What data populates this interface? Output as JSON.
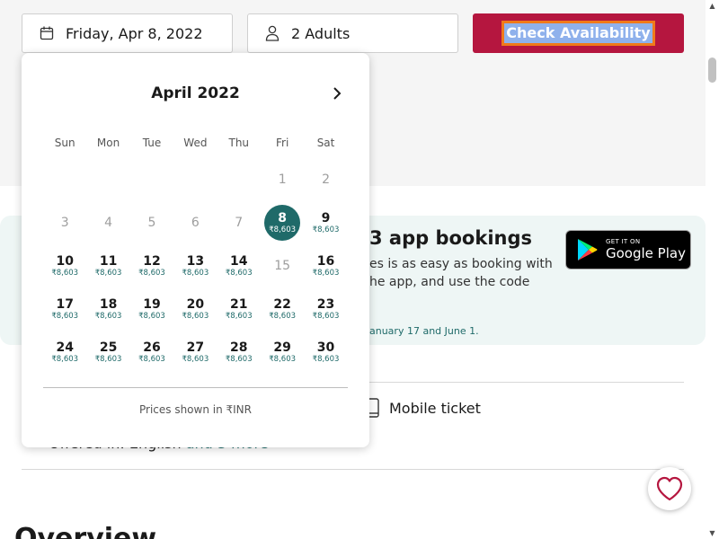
{
  "search_bar": {
    "date_value": "Friday, Apr 8, 2022",
    "guests_value": "2 Adults",
    "check_label": "Check Availability"
  },
  "promo": {
    "title": "3 app bookings",
    "text": "es is as easy as booking with he app, and use the code",
    "note": "anuary 17 and June 1.",
    "store_small": "GET IT ON",
    "store_big": "Google Play"
  },
  "details": {
    "mobile_ticket": "Mobile ticket",
    "offered_prefix": "Offered in: English",
    "offered_more": "and 3 more"
  },
  "overview_heading": "Overview",
  "calendar": {
    "month_title": "April 2022",
    "weekdays": [
      "Sun",
      "Mon",
      "Tue",
      "Wed",
      "Thu",
      "Fri",
      "Sat"
    ],
    "leading_blanks": 5,
    "days": [
      {
        "day": "1",
        "price": "",
        "disabled": true
      },
      {
        "day": "2",
        "price": "",
        "disabled": true
      },
      {
        "day": "3",
        "price": "",
        "disabled": true
      },
      {
        "day": "4",
        "price": "",
        "disabled": true
      },
      {
        "day": "5",
        "price": "",
        "disabled": true
      },
      {
        "day": "6",
        "price": "",
        "disabled": true
      },
      {
        "day": "7",
        "price": "",
        "disabled": true
      },
      {
        "day": "8",
        "price": "₹8,603",
        "selected": true
      },
      {
        "day": "9",
        "price": "₹8,603"
      },
      {
        "day": "10",
        "price": "₹8,603"
      },
      {
        "day": "11",
        "price": "₹8,603"
      },
      {
        "day": "12",
        "price": "₹8,603"
      },
      {
        "day": "13",
        "price": "₹8,603"
      },
      {
        "day": "14",
        "price": "₹8,603"
      },
      {
        "day": "15",
        "price": "",
        "disabled": true
      },
      {
        "day": "16",
        "price": "₹8,603"
      },
      {
        "day": "17",
        "price": "₹8,603"
      },
      {
        "day": "18",
        "price": "₹8,603"
      },
      {
        "day": "19",
        "price": "₹8,603"
      },
      {
        "day": "20",
        "price": "₹8,603"
      },
      {
        "day": "21",
        "price": "₹8,603"
      },
      {
        "day": "22",
        "price": "₹8,603"
      },
      {
        "day": "23",
        "price": "₹8,603"
      },
      {
        "day": "24",
        "price": "₹8,603"
      },
      {
        "day": "25",
        "price": "₹8,603"
      },
      {
        "day": "26",
        "price": "₹8,603"
      },
      {
        "day": "27",
        "price": "₹8,603"
      },
      {
        "day": "28",
        "price": "₹8,603"
      },
      {
        "day": "29",
        "price": "₹8,603"
      },
      {
        "day": "30",
        "price": "₹8,603"
      }
    ],
    "footer": "Prices shown in ₹INR"
  },
  "colors": {
    "brand_red": "#b5163f",
    "teal": "#1f6a69",
    "focus_outline": "#f07a1a"
  }
}
